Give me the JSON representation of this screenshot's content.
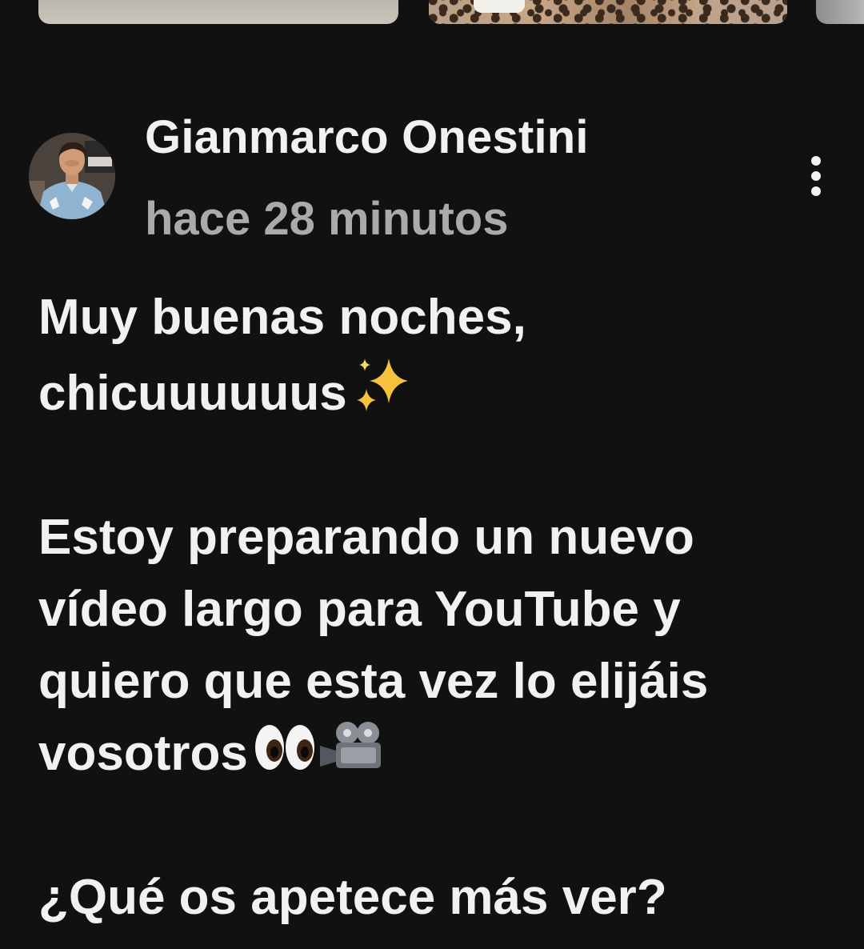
{
  "thumbnails": [
    {
      "icon": "photo-thumbnail"
    },
    {
      "icon": "photo-thumbnail"
    },
    {
      "icon": "photo-thumbnail"
    }
  ],
  "post": {
    "author": "Gianmarco Onestini",
    "timestamp": "hace 28 minutos",
    "avatar_icon": "profile-photo",
    "menu_icon": "more-vertical-icon",
    "lines": [
      "Muy buenas noches,",
      "chicuuuuuus",
      "Estoy preparando un nuevo",
      "vídeo largo para YouTube y",
      "quiero que esta vez lo elijáis",
      "vosotros",
      "¿Qué os apetece más ver?"
    ],
    "emojis": {
      "sparkles": "sparkles-emoji",
      "eyes": "eyes-emoji",
      "camera": "movie-camera-emoji"
    }
  },
  "colors": {
    "background": "#111111",
    "text_primary": "#f1f1f1",
    "text_secondary": "#aaaaaa"
  }
}
